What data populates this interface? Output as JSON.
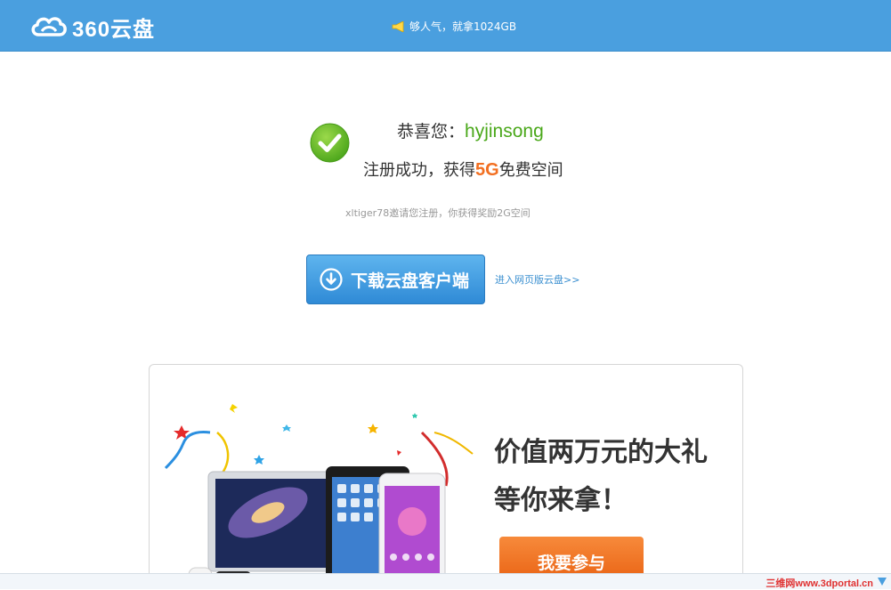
{
  "header": {
    "logo_text": "360云盘",
    "promo_text": "够人气，就拿1024GB"
  },
  "success": {
    "greet_prefix": "恭喜您：",
    "username": "hyjinsong",
    "msg_prefix": "注册成功，获得",
    "msg_size": "5G",
    "msg_suffix": "免费空间",
    "invite_text": "xltiger78邀请您注册，你获得奖励2G空间"
  },
  "download": {
    "button_label": "下载云盘客户端",
    "web_link": "进入网页版云盘>>"
  },
  "promo_card": {
    "title_line1": "价值两万元的大礼",
    "title_line2": "等你来拿！",
    "join_label": "我要参与"
  },
  "bottom": {
    "watermark": "三维网www.3dportal.cn"
  },
  "colors": {
    "header_bg": "#4a9fdf",
    "username": "#4aa81a",
    "size_highlight": "#f26f21",
    "download_button": "#3e97e0",
    "join_button": "#ee6a1c"
  },
  "icons": [
    "cloud-logo-icon",
    "megaphone-icon",
    "checkmark-icon",
    "download-arrow-icon",
    "corner-arrow-icon"
  ]
}
